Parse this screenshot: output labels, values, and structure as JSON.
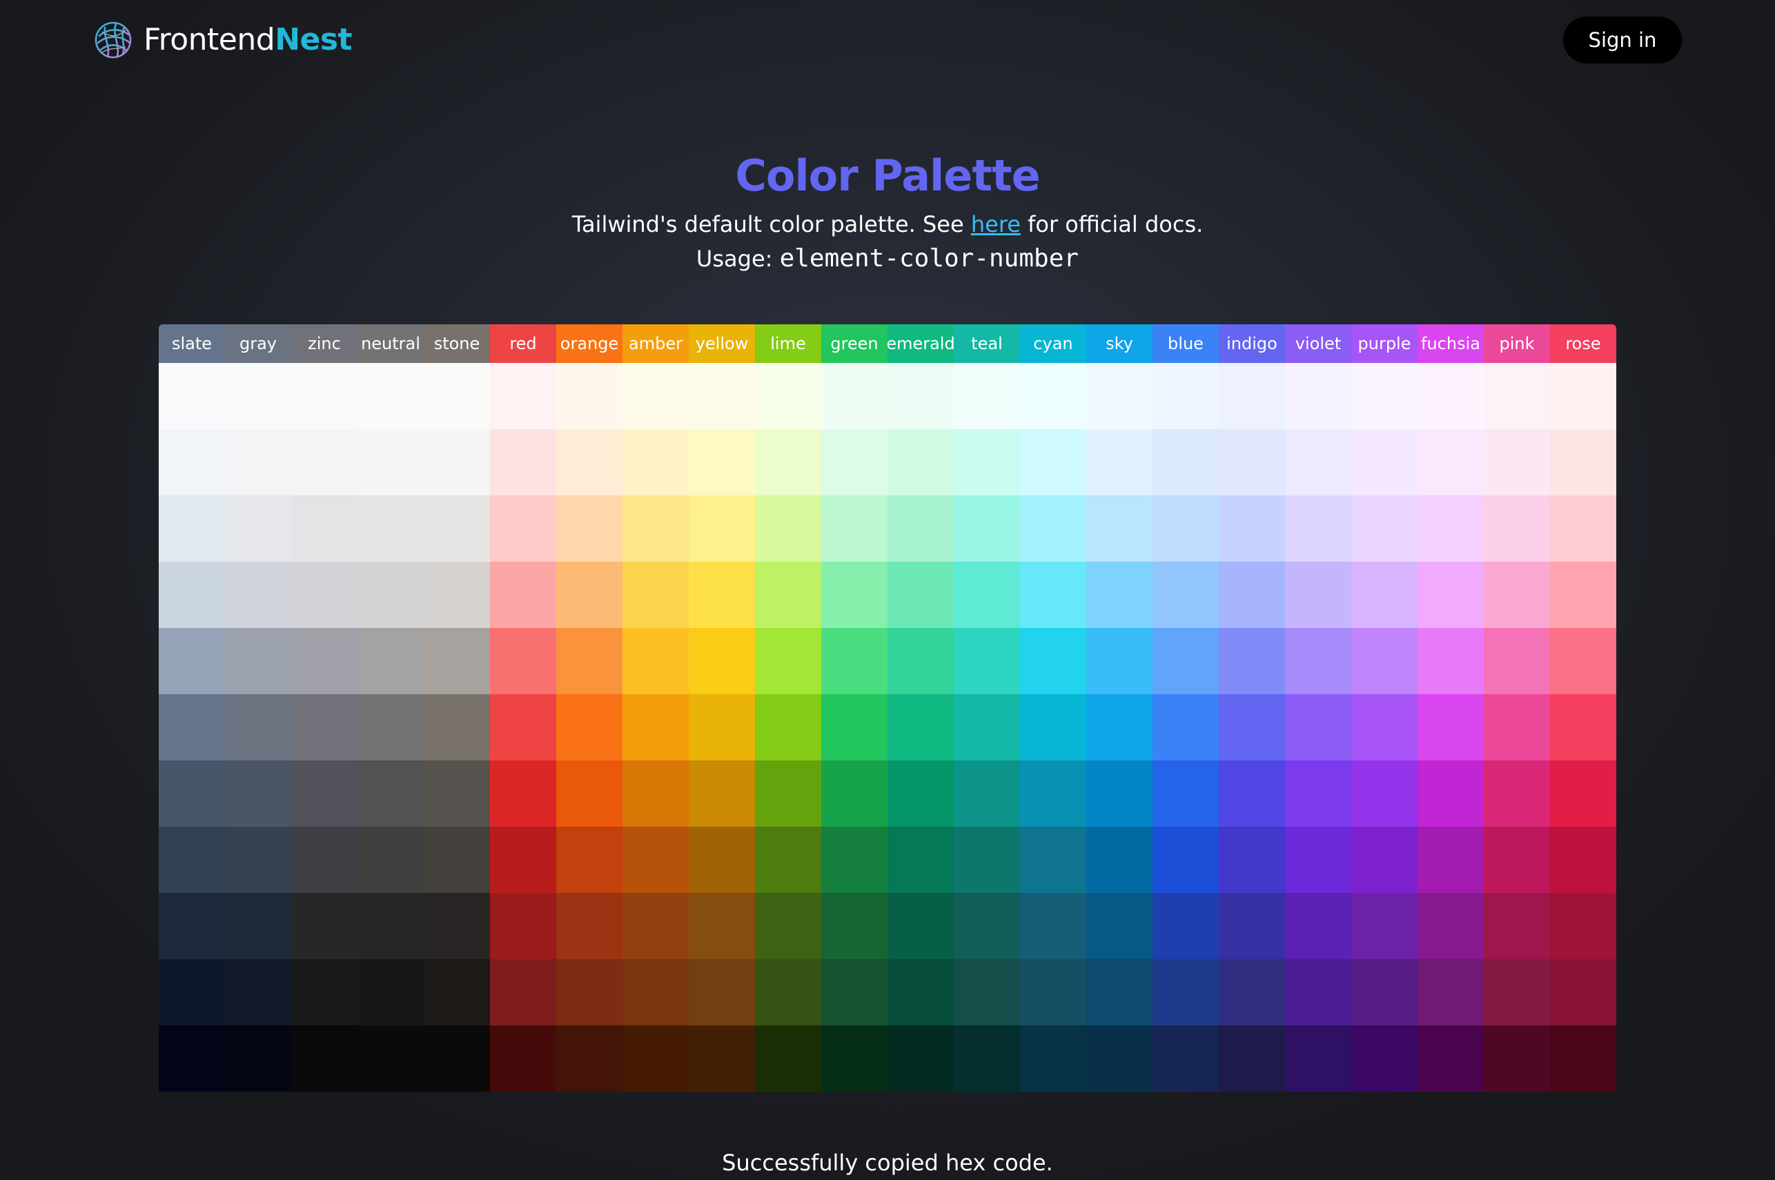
{
  "header": {
    "logo_text_1": "Frontend",
    "logo_text_2": "Nest",
    "logo_icon": "nest-logo-icon",
    "signin_label": "Sign in"
  },
  "hero": {
    "title": "Color Palette",
    "subtitle_before": "Tailwind's default color palette. See ",
    "subtitle_link": "here",
    "subtitle_after": " for official docs.",
    "usage_label": "Usage: ",
    "usage_code": "element-color-number"
  },
  "palette": {
    "colors": [
      {
        "name": "slate",
        "shades": [
          "#f8fafc",
          "#f1f5f9",
          "#e2e8f0",
          "#cbd5e1",
          "#94a3b8",
          "#64748b",
          "#475569",
          "#334155",
          "#1e293b",
          "#0f172a",
          "#020617"
        ]
      },
      {
        "name": "gray",
        "shades": [
          "#f9fafb",
          "#f3f4f6",
          "#e5e7eb",
          "#d1d5db",
          "#9ca3af",
          "#6b7280",
          "#4b5563",
          "#374151",
          "#1f2937",
          "#111827",
          "#030712"
        ]
      },
      {
        "name": "zinc",
        "shades": [
          "#fafafa",
          "#f4f4f5",
          "#e4e4e7",
          "#d4d4d8",
          "#a1a1aa",
          "#71717a",
          "#52525b",
          "#3f3f46",
          "#27272a",
          "#18181b",
          "#09090b"
        ]
      },
      {
        "name": "neutral",
        "shades": [
          "#fafafa",
          "#f5f5f5",
          "#e5e5e5",
          "#d4d4d4",
          "#a3a3a3",
          "#737373",
          "#525252",
          "#404040",
          "#262626",
          "#171717",
          "#0a0a0a"
        ]
      },
      {
        "name": "stone",
        "shades": [
          "#fafaf9",
          "#f5f5f4",
          "#e7e5e4",
          "#d6d3d1",
          "#a8a29e",
          "#78716c",
          "#57534e",
          "#44403c",
          "#292524",
          "#1c1917",
          "#0c0a09"
        ]
      },
      {
        "name": "red",
        "shades": [
          "#fef2f2",
          "#fee2e2",
          "#fecaca",
          "#fca5a5",
          "#f87171",
          "#ef4444",
          "#dc2626",
          "#b91c1c",
          "#991b1b",
          "#7f1d1d",
          "#450a0a"
        ]
      },
      {
        "name": "orange",
        "shades": [
          "#fff7ed",
          "#ffedd5",
          "#fed7aa",
          "#fdba74",
          "#fb923c",
          "#f97316",
          "#ea580c",
          "#c2410c",
          "#9a3412",
          "#7c2d12",
          "#431407"
        ]
      },
      {
        "name": "amber",
        "shades": [
          "#fffbeb",
          "#fef3c7",
          "#fde68a",
          "#fcd34d",
          "#fbbf24",
          "#f59e0b",
          "#d97706",
          "#b45309",
          "#92400e",
          "#78350f",
          "#451a03"
        ]
      },
      {
        "name": "yellow",
        "shades": [
          "#fefce8",
          "#fef9c3",
          "#fef08a",
          "#fde047",
          "#facc15",
          "#eab308",
          "#ca8a04",
          "#a16207",
          "#854d0e",
          "#713f12",
          "#422006"
        ]
      },
      {
        "name": "lime",
        "shades": [
          "#f7fee7",
          "#ecfccb",
          "#d9f99d",
          "#bef264",
          "#a3e635",
          "#84cc16",
          "#65a30d",
          "#4d7c0f",
          "#3f6212",
          "#365314",
          "#1a2e05"
        ]
      },
      {
        "name": "green",
        "shades": [
          "#f0fdf4",
          "#dcfce7",
          "#bbf7d0",
          "#86efac",
          "#4ade80",
          "#22c55e",
          "#16a34a",
          "#15803d",
          "#166534",
          "#14532d",
          "#052e16"
        ]
      },
      {
        "name": "emerald",
        "shades": [
          "#ecfdf5",
          "#d1fae5",
          "#a7f3d0",
          "#6ee7b7",
          "#34d399",
          "#10b981",
          "#059669",
          "#047857",
          "#065f46",
          "#064e3b",
          "#022c22"
        ]
      },
      {
        "name": "teal",
        "shades": [
          "#f0fdfa",
          "#ccfbf1",
          "#99f6e4",
          "#5eead4",
          "#2dd4bf",
          "#14b8a6",
          "#0d9488",
          "#0f766e",
          "#115e59",
          "#134e4a",
          "#042f2e"
        ]
      },
      {
        "name": "cyan",
        "shades": [
          "#ecfeff",
          "#cffafe",
          "#a5f3fc",
          "#67e8f9",
          "#22d3ee",
          "#06b6d4",
          "#0891b2",
          "#0e7490",
          "#155e75",
          "#164e63",
          "#083344"
        ]
      },
      {
        "name": "sky",
        "shades": [
          "#f0f9ff",
          "#e0f2fe",
          "#bae6fd",
          "#7dd3fc",
          "#38bdf8",
          "#0ea5e9",
          "#0284c7",
          "#0369a1",
          "#075985",
          "#0c4a6e",
          "#082f49"
        ]
      },
      {
        "name": "blue",
        "shades": [
          "#eff6ff",
          "#dbeafe",
          "#bfdbfe",
          "#93c5fd",
          "#60a5fa",
          "#3b82f6",
          "#2563eb",
          "#1d4ed8",
          "#1e40af",
          "#1e3a8a",
          "#172554"
        ]
      },
      {
        "name": "indigo",
        "shades": [
          "#eef2ff",
          "#e0e7ff",
          "#c7d2fe",
          "#a5b4fc",
          "#818cf8",
          "#6366f1",
          "#4f46e5",
          "#4338ca",
          "#3730a3",
          "#312e81",
          "#1e1b4b"
        ]
      },
      {
        "name": "violet",
        "shades": [
          "#f5f3ff",
          "#ede9fe",
          "#ddd6fe",
          "#c4b5fd",
          "#a78bfa",
          "#8b5cf6",
          "#7c3aed",
          "#6d28d9",
          "#5b21b6",
          "#4c1d95",
          "#2e1065"
        ]
      },
      {
        "name": "purple",
        "shades": [
          "#faf5ff",
          "#f3e8ff",
          "#e9d5ff",
          "#d8b4fe",
          "#c084fc",
          "#a855f7",
          "#9333ea",
          "#7e22ce",
          "#6b21a8",
          "#581c87",
          "#3b0764"
        ]
      },
      {
        "name": "fuchsia",
        "shades": [
          "#fdf4ff",
          "#fae8ff",
          "#f5d0fe",
          "#f0abfc",
          "#e879f9",
          "#d946ef",
          "#c026d3",
          "#a21caf",
          "#86198f",
          "#701a75",
          "#4a044e"
        ]
      },
      {
        "name": "pink",
        "shades": [
          "#fdf2f8",
          "#fce7f3",
          "#fbcfe8",
          "#f9a8d4",
          "#f472b6",
          "#ec4899",
          "#db2777",
          "#be185d",
          "#9d174d",
          "#831843",
          "#500724"
        ]
      },
      {
        "name": "rose",
        "shades": [
          "#fff1f2",
          "#ffe4e6",
          "#fecdd3",
          "#fda4af",
          "#fb7185",
          "#f43f5e",
          "#e11d48",
          "#be123c",
          "#9f1239",
          "#881337",
          "#4c0519"
        ]
      }
    ]
  },
  "status": {
    "message": "Successfully copied hex code."
  }
}
